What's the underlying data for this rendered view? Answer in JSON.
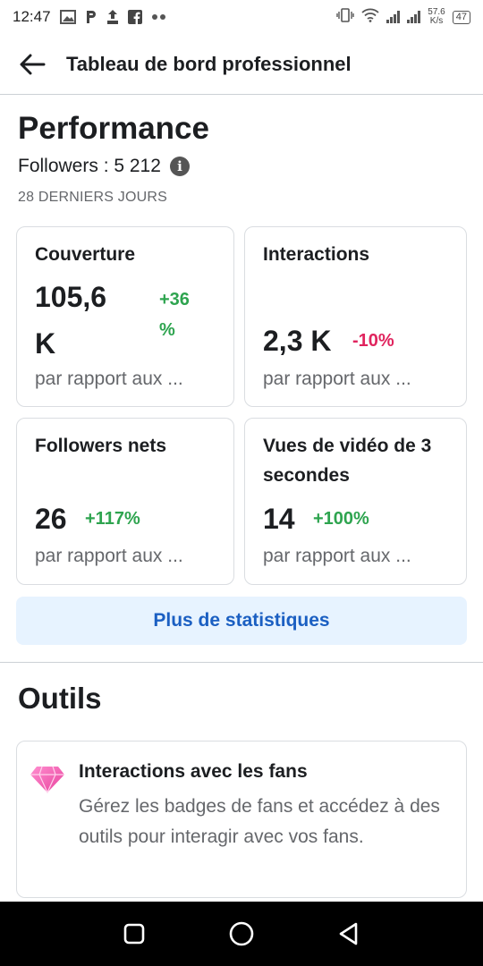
{
  "status_bar": {
    "time": "12:47",
    "icons": [
      "image-icon",
      "p-icon",
      "upload-icon",
      "facebook-icon",
      "more-dots-icon"
    ],
    "speed_value": "57.6",
    "speed_unit": "K/s",
    "battery": "47"
  },
  "header": {
    "title": "Tableau de bord professionnel"
  },
  "performance": {
    "title": "Performance",
    "followers_label": "Followers : 5 212",
    "period": "28 DERNIERS JOURS"
  },
  "cards": [
    {
      "label": "Couverture",
      "value": "105,6\nK",
      "change": "+36\n%",
      "compare": "par rapport aux ..."
    },
    {
      "label": "Interactions",
      "value": "2,3 K",
      "change": "-10%",
      "compare": "par rapport aux ..."
    },
    {
      "label": "Followers nets",
      "value": "26",
      "change": "+117%",
      "compare": "par rapport aux ..."
    },
    {
      "label": "Vues de vidéo de 3 secondes",
      "value": "14",
      "change": "+100%",
      "compare": "par rapport aux ..."
    }
  ],
  "more_stats_label": "Plus de statistiques",
  "tools": {
    "title": "Outils",
    "items": [
      {
        "title": "Interactions avec les fans",
        "description": "Gérez les badges de fans et accédez à des outils pour interagir avec vos fans.",
        "icon": "diamond-icon"
      }
    ]
  },
  "colors": {
    "positive": "#2ea44f",
    "negative": "#e0245e",
    "link": "#1b5fc2",
    "button_bg": "#e7f3ff"
  }
}
